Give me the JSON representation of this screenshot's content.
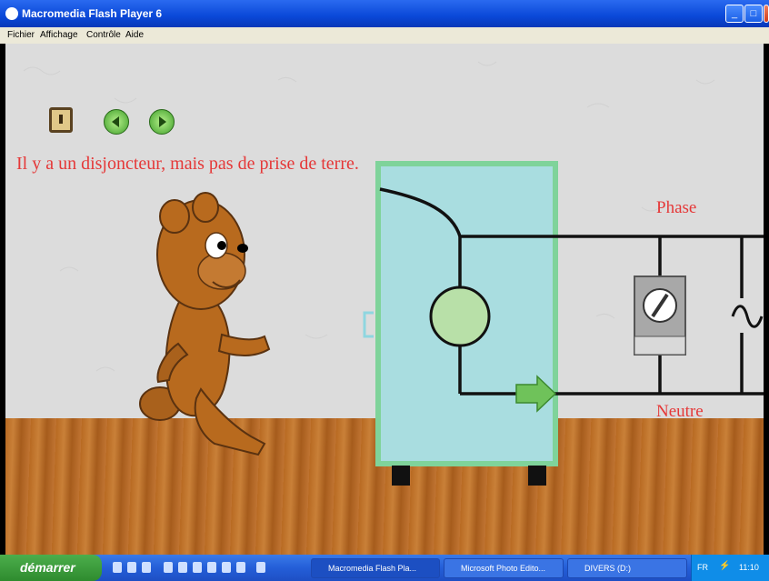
{
  "window": {
    "title": "Macromedia Flash Player 6",
    "controls": [
      "minimize",
      "maximize",
      "close"
    ]
  },
  "menu": [
    "Fichier",
    "Affichage",
    "Contrôle",
    "Aide"
  ],
  "scene": {
    "caption": "Il y a un disjoncteur, mais pas de prise de terre.",
    "phase_label": "Phase",
    "neutre_label": "Neutre",
    "nav_buttons": {
      "home": "home-icon",
      "previous": "arrow-left-icon",
      "next": "arrow-right-icon"
    },
    "colors": {
      "text_red": "#e53838",
      "appliance_fill": "#a9dde0",
      "appliance_border": "#7fd39a",
      "circle_fill": "#b8e0a8",
      "arrow_green": "#6fc25a",
      "bear_brown": "#b86a1e"
    }
  },
  "taskbar": {
    "start_label": "démarrer",
    "tasks": [
      "Macromedia Flash Pla...",
      "Microsoft Photo Edito...",
      "DIVERS (D:)"
    ],
    "tray": {
      "lang": "FR",
      "clock": "11:10"
    }
  }
}
